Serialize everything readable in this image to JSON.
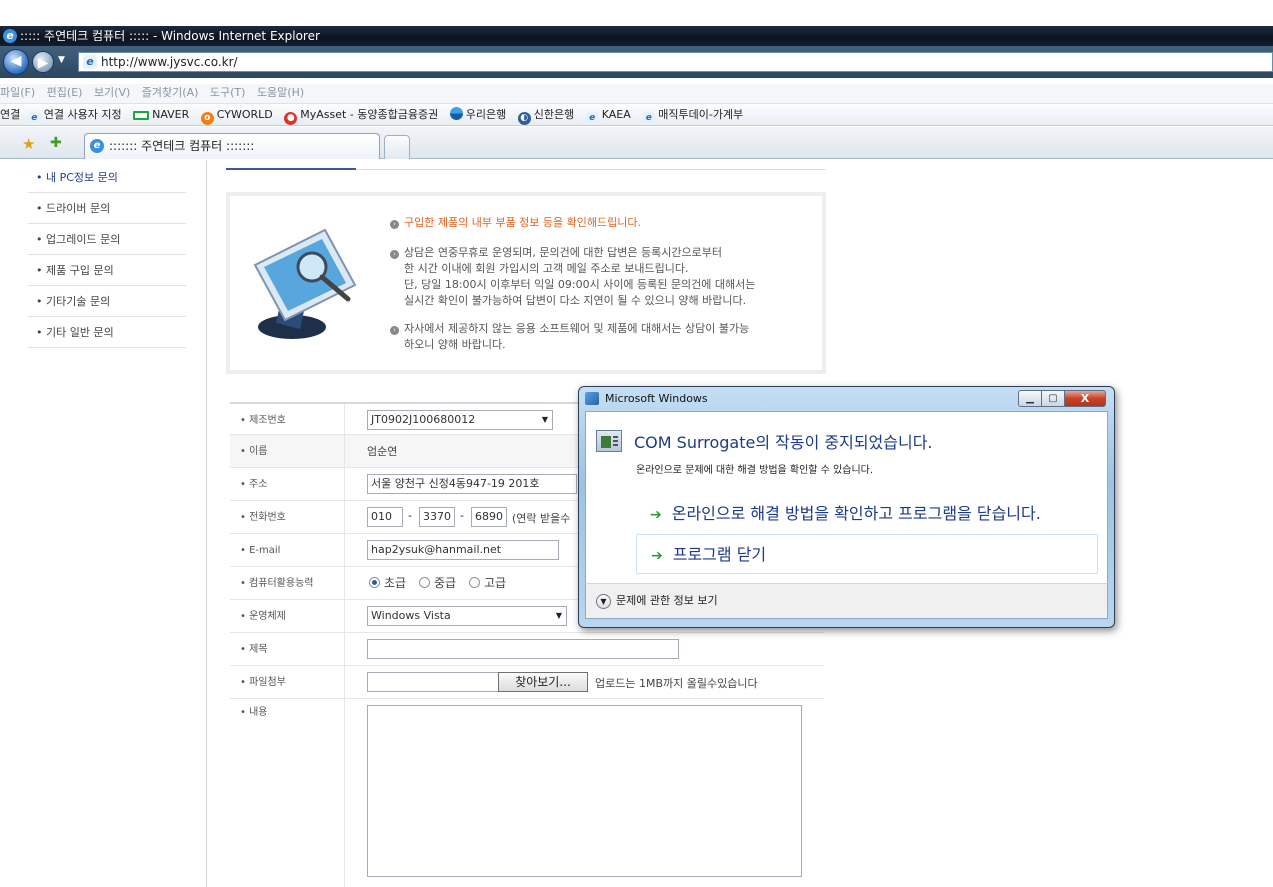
{
  "browser": {
    "title": "::::: 주연테크 컴퓨터 ::::: - Windows Internet Explorer",
    "url": "http://www.jysvc.co.kr/",
    "menu": [
      "파일(F)",
      "편집(E)",
      "보기(V)",
      "즐겨찾기(A)",
      "도구(T)",
      "도움말(H)"
    ],
    "links_label": "연결",
    "links": [
      {
        "label": "연결 사용자 지정",
        "icon": "ie-icon"
      },
      {
        "label": "NAVER",
        "icon": "naver-icon"
      },
      {
        "label": "CYWORLD",
        "icon": "cyworld-icon"
      },
      {
        "label": "MyAsset - 동양종합금융증권",
        "icon": "myasset-icon"
      },
      {
        "label": "우리은행",
        "icon": "woori-icon"
      },
      {
        "label": "신한은행",
        "icon": "shinhan-icon"
      },
      {
        "label": "KAEA",
        "icon": "ie-icon"
      },
      {
        "label": "매직투데이-가계부",
        "icon": "ie-icon"
      }
    ],
    "tab_title": "::::::: 주연테크 컴퓨터 :::::::"
  },
  "sidebar": {
    "items": [
      {
        "label": "• 내 PC정보 문의",
        "active": true
      },
      {
        "label": "• 드라이버 문의"
      },
      {
        "label": "• 업그레이드 문의"
      },
      {
        "label": "• 제품 구입 문의"
      },
      {
        "label": "• 기타기술 문의"
      },
      {
        "label": "• 기타 일반 문의"
      }
    ]
  },
  "notice": {
    "line1": "구입한 제품의 내부 부품 정보 등을 확인해드립니다.",
    "line2a": "상담은 연중무휴로 운영되며, 문의건에 대한 답변은 등록시간으로부터",
    "line2b": "한 시간 이내에 회원 가입시의 고객 메일 주소로 보내드립니다.",
    "line2c": "단, 당일 18:00시 이후부터 익일 09:00시 사이에 등록된 문의건에 대해서는",
    "line2d": "실시간 확인이 불가능하여 답변이 다소 지연이 될 수 있으니 양해 바랍니다.",
    "line3a": "자사에서 제공하지 않는 응용 소프트웨어 및 제품에 대해서는 상담이 불가능",
    "line3b": "하오니 양해 바랍니다."
  },
  "form": {
    "serial_label": "• 제조번호",
    "serial_value": "JT0902J100680012",
    "name_label": "• 이름",
    "name_value": "엄순연",
    "address_label": "• 주소",
    "address_value": "서울 양천구 신정4동947-19 201호",
    "phone_label": "• 전화번호",
    "phone_1": "010",
    "phone_2": "3370",
    "phone_3": "6890",
    "phone_dash": "-",
    "phone_note": "(연락 받을수",
    "email_label": "• E-mail",
    "email_value": "hap2ysuk@hanmail.net",
    "skill_label": "• 컴퓨터활용능력",
    "skill_options": [
      "초급",
      "중급",
      "고급"
    ],
    "skill_selected": "초급",
    "os_label": "• 운영체제",
    "os_value": "Windows Vista",
    "subject_label": "• 제목",
    "subject_value": "",
    "attach_label": "• 파일첨부",
    "browse_label": "찾아보기...",
    "attach_note": "업로드는 1MB까지 올릴수있습니다",
    "content_label": "• 내용",
    "content_value": ""
  },
  "dialog": {
    "title": "Microsoft Windows",
    "heading": "COM Surrogate의 작동이 중지되었습니다.",
    "sub": "온라인으로 문제에 대한 해결 방법을 확인할 수 있습니다.",
    "cmd_online": "온라인으로 해결 방법을 확인하고 프로그램을 닫습니다.",
    "cmd_close": "프로그램 닫기",
    "details": "문제에 관한 정보 보기",
    "min_glyph": "▁",
    "max_glyph": "▢",
    "close_glyph": "X"
  },
  "colors": {
    "notice_accent": "#e2631d",
    "link_blue": "#1b3a8c",
    "active_sidebar": "#1f3f8a"
  }
}
